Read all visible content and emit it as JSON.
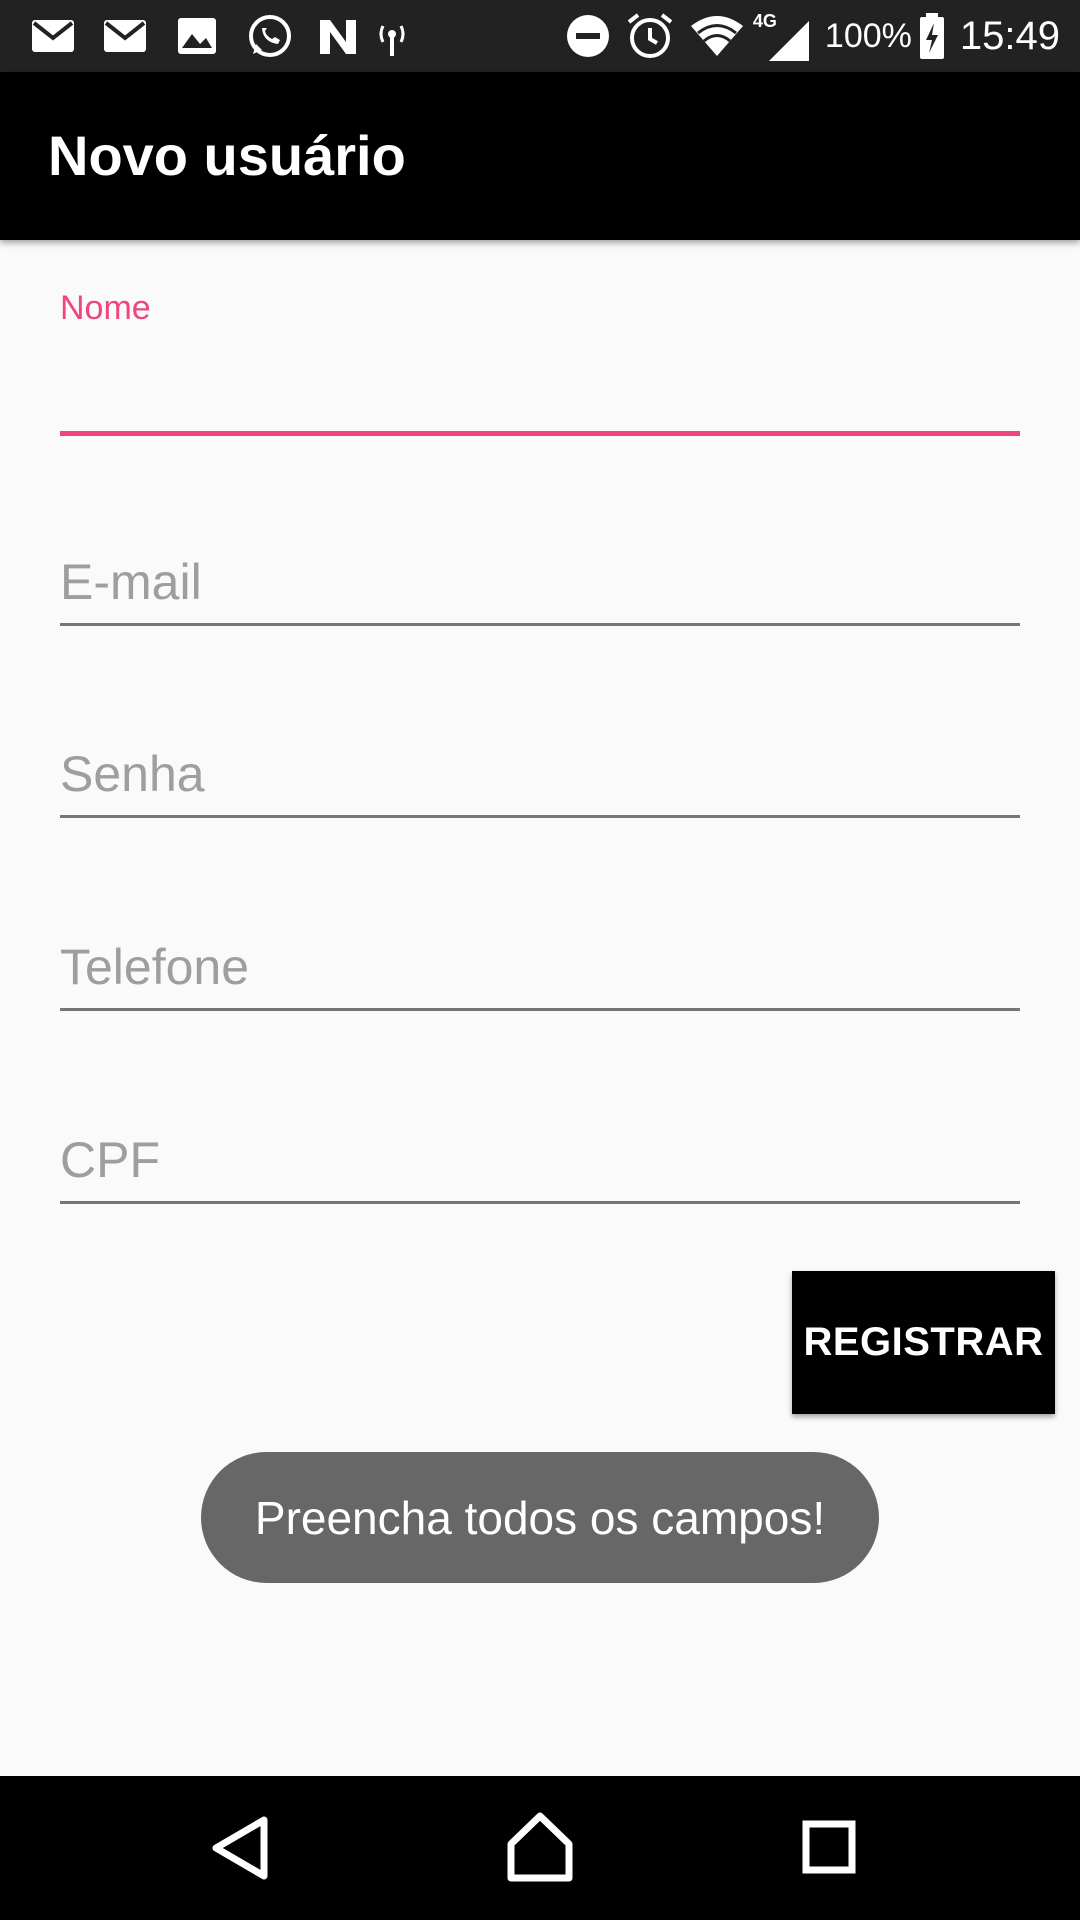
{
  "status_bar": {
    "battery": "100%",
    "time": "15:49",
    "network": "4G",
    "icons": [
      "mail-icon",
      "mail-icon",
      "image-icon",
      "whatsapp-icon",
      "n-app-icon",
      "hotspot-icon",
      "do-not-disturb-icon",
      "alarm-icon",
      "wifi-icon",
      "cell-signal-icon",
      "battery-charging-icon"
    ]
  },
  "toolbar": {
    "title": "Novo usuário"
  },
  "form": {
    "nome": {
      "label": "Nome",
      "value": ""
    },
    "email": {
      "placeholder": "E-mail",
      "value": ""
    },
    "senha": {
      "placeholder": "Senha",
      "value": ""
    },
    "telefone": {
      "placeholder": "Telefone",
      "value": ""
    },
    "cpf": {
      "placeholder": "CPF",
      "value": ""
    },
    "register_label": "REGISTRAR"
  },
  "toast": {
    "message": "Preencha todos os campos!"
  },
  "nav_bar": {
    "icons": [
      "back-icon",
      "home-icon",
      "recents-icon"
    ]
  },
  "colors": {
    "accent": "#f0457f",
    "toolbar": "#000000",
    "background": "#fafafa",
    "toast": "#676767"
  }
}
